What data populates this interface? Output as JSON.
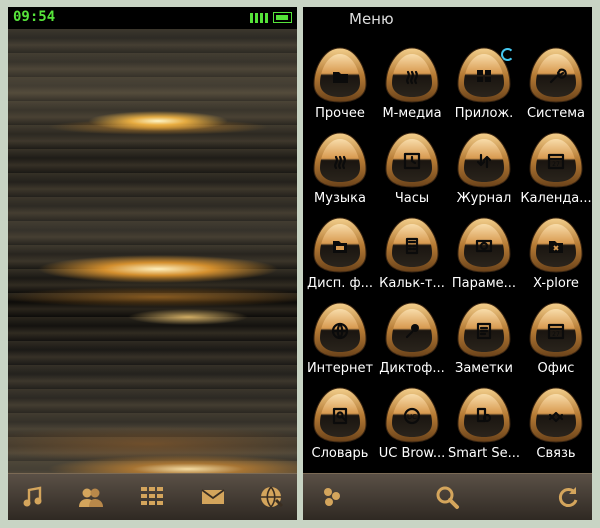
{
  "left_screen": {
    "status": {
      "time": "09:54"
    },
    "bottom_bar": [
      "music-icon",
      "contacts-icon",
      "dialpad-icon",
      "mail-icon",
      "browser-icon"
    ]
  },
  "right_screen": {
    "title": "Меню",
    "apps": [
      {
        "label": "Прочее",
        "icon": "folder-icon"
      },
      {
        "label": "М-медиа",
        "icon": "media-waves-icon"
      },
      {
        "label": "Прилож.",
        "icon": "apps-grid-icon"
      },
      {
        "label": "Система",
        "icon": "wrench-icon"
      },
      {
        "label": "Музыка",
        "icon": "music-waves-icon"
      },
      {
        "label": "Часы",
        "icon": "clock-icon"
      },
      {
        "label": "Журнал",
        "icon": "log-arrows-icon"
      },
      {
        "label": "Календа...",
        "icon": "calendar-icon"
      },
      {
        "label": "Дисп. ф...",
        "icon": "file-manager-icon"
      },
      {
        "label": "Кальк-т...",
        "icon": "calculator-icon"
      },
      {
        "label": "Параме...",
        "icon": "settings-icon"
      },
      {
        "label": "X-plore",
        "icon": "x-folder-icon"
      },
      {
        "label": "Интернет",
        "icon": "globe-icon"
      },
      {
        "label": "Диктоф...",
        "icon": "microphone-icon"
      },
      {
        "label": "Заметки",
        "icon": "notes-icon"
      },
      {
        "label": "Офис",
        "icon": "calendar-office-icon"
      },
      {
        "label": "Словарь",
        "icon": "dictionary-icon"
      },
      {
        "label": "UC Brow...",
        "icon": "uc-browser-icon"
      },
      {
        "label": "Smart Se...",
        "icon": "smart-search-icon"
      },
      {
        "label": "Связь",
        "icon": "connectivity-icon"
      }
    ],
    "bottom_bar": [
      "options-icon",
      "search-icon",
      "refresh-icon"
    ]
  }
}
